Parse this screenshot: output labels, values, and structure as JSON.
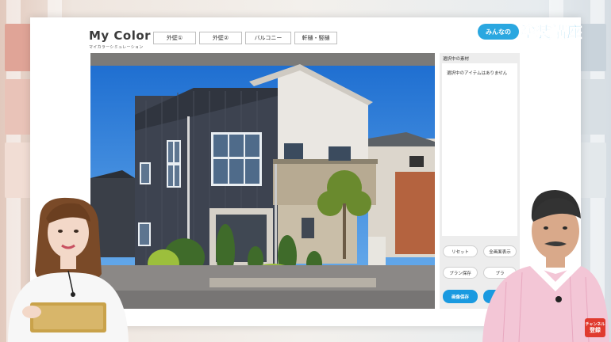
{
  "app": {
    "logo_text": "My Color",
    "logo_subtitle": "マイカラーシミュレーション"
  },
  "tabs": [
    {
      "label": "外壁①"
    },
    {
      "label": "外壁②"
    },
    {
      "label": "バルコニー"
    },
    {
      "label": "軒樋・竪樋"
    }
  ],
  "side_panel": {
    "title": "選択中の素材",
    "empty_message": "選択中のアイテムはありません",
    "reset_label": "リセット",
    "fullscreen_label": "全画面表示",
    "save_plan_label": "プラン保存",
    "second_plan_label": "プラ",
    "save_image_label": "画像保存"
  },
  "brand": {
    "pill_text": "みんなの",
    "title": "塗装講座"
  },
  "badge": {
    "line1": "チャンネル",
    "line2": "登録"
  },
  "colors": {
    "accent_blue": "#1a9ae0",
    "brand_blue": "#2aa7e0",
    "badge_red": "#e03a2e"
  }
}
